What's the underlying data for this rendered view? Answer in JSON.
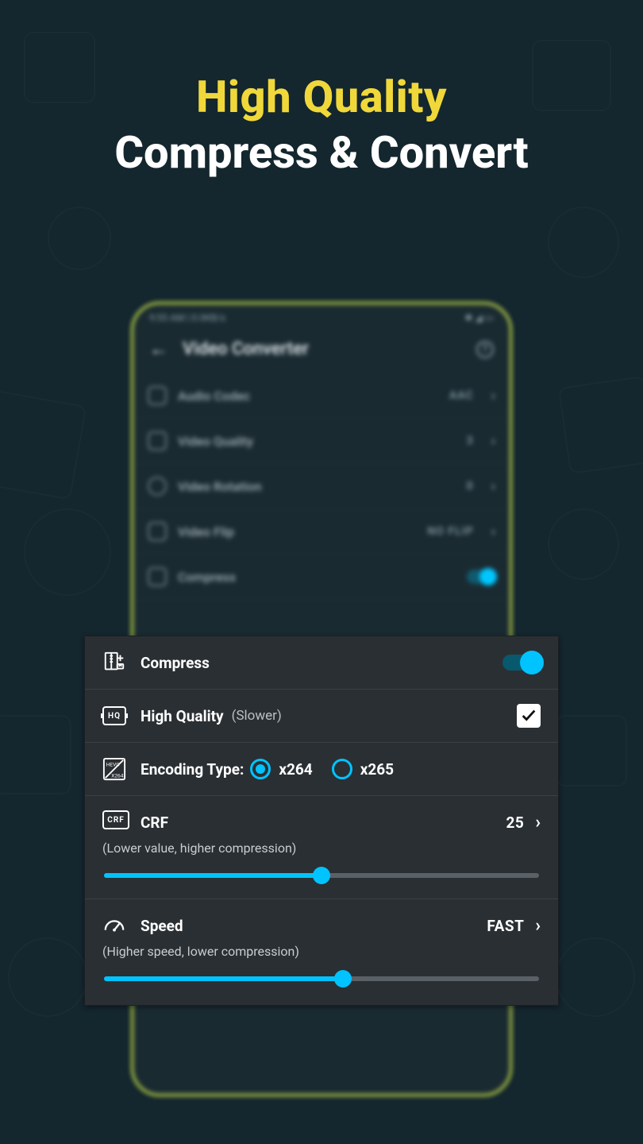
{
  "headline": {
    "line1": "High Quality",
    "line2": "Compress & Convert"
  },
  "phone": {
    "status_time": "9:55 AM | 0.0KB/s",
    "title": "Video Converter",
    "rows": [
      {
        "label": "Audio Codec",
        "value": "AAC"
      },
      {
        "label": "Video Quality",
        "value": "3"
      },
      {
        "label": "Video Rotation",
        "value": "0"
      },
      {
        "label": "Video Flip",
        "value": "NO FLIP"
      }
    ],
    "compress_label": "Compress"
  },
  "card": {
    "compress": {
      "label": "Compress",
      "on": true
    },
    "hq": {
      "label": "High Quality",
      "sub": "(Slower)",
      "checked": true
    },
    "encoding": {
      "label": "Encoding Type:",
      "options": [
        "x264",
        "x265"
      ],
      "selected": "x264"
    },
    "crf": {
      "label": "CRF",
      "value": "25",
      "hint": "(Lower value, higher compression)",
      "percent": 50
    },
    "speed": {
      "label": "Speed",
      "value": "FAST",
      "hint": "(Higher speed, lower compression)",
      "percent": 55
    }
  }
}
